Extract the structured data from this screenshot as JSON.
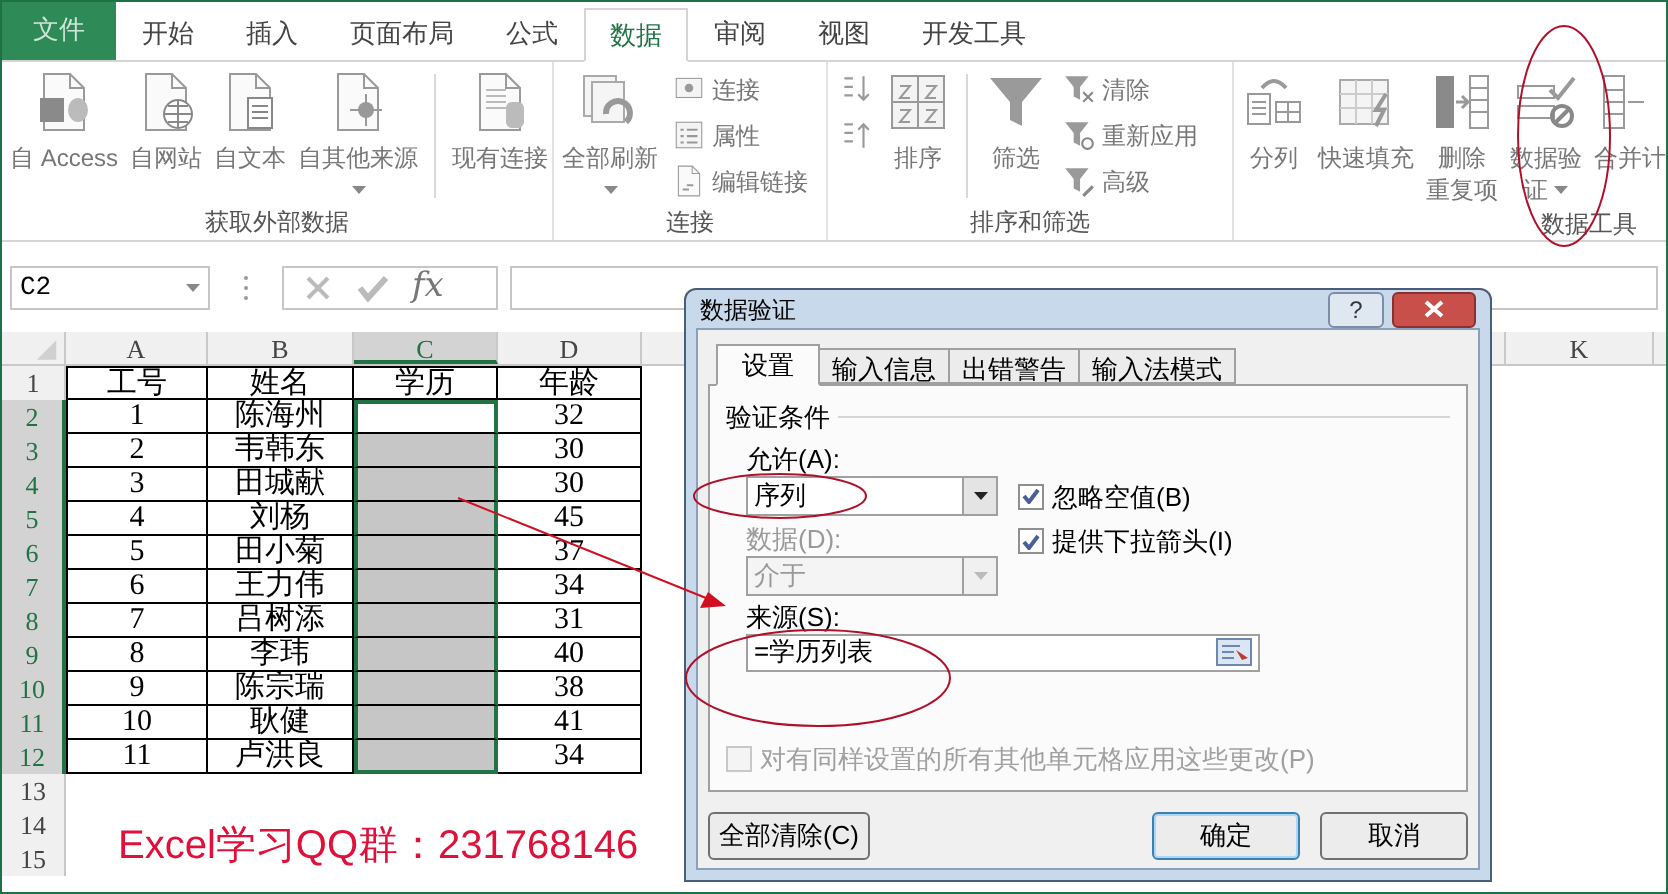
{
  "ribbon_tabs": [
    {
      "label": "文件",
      "kind": "file",
      "selected": false
    },
    {
      "label": "开始",
      "kind": "tab",
      "selected": false
    },
    {
      "label": "插入",
      "kind": "tab",
      "selected": false
    },
    {
      "label": "页面布局",
      "kind": "tab",
      "selected": false
    },
    {
      "label": "公式",
      "kind": "tab",
      "selected": false
    },
    {
      "label": "数据",
      "kind": "tab",
      "selected": true
    },
    {
      "label": "审阅",
      "kind": "tab",
      "selected": false
    },
    {
      "label": "视图",
      "kind": "tab",
      "selected": false
    },
    {
      "label": "开发工具",
      "kind": "tab",
      "selected": false
    }
  ],
  "ribbon_groups": [
    {
      "label": "获取外部数据",
      "buttons": [
        {
          "kind": "large",
          "lines": [
            "自 Access"
          ]
        },
        {
          "kind": "large",
          "lines": [
            "自网站"
          ]
        },
        {
          "kind": "large",
          "lines": [
            "自文本"
          ]
        },
        {
          "kind": "large",
          "lines": [
            "自其他来源"
          ],
          "dropdown": true
        },
        {
          "kind": "large",
          "lines": [
            "现有连接"
          ],
          "divider_before": true
        }
      ]
    },
    {
      "label": "连接",
      "buttons": [
        {
          "kind": "large",
          "lines": [
            "全部刷新"
          ],
          "dropdown": true
        },
        {
          "kind": "stack",
          "items": [
            {
              "kind": "text",
              "label": "连接"
            },
            {
              "kind": "text",
              "label": "属性"
            },
            {
              "kind": "text",
              "label": "编辑链接"
            }
          ]
        }
      ]
    },
    {
      "label": "排序和筛选",
      "buttons": [
        {
          "kind": "stack",
          "items": [
            {
              "kind": "icon"
            },
            {
              "kind": "icon"
            }
          ]
        },
        {
          "kind": "large",
          "lines": [
            "排序"
          ]
        },
        {
          "kind": "large",
          "lines": [
            "筛选"
          ],
          "divider_before": true
        },
        {
          "kind": "stack",
          "items": [
            {
              "kind": "text",
              "label": "清除"
            },
            {
              "kind": "text",
              "label": "重新应用"
            },
            {
              "kind": "text",
              "label": "高级"
            }
          ]
        }
      ]
    },
    {
      "label": "数据工具",
      "buttons": [
        {
          "kind": "large",
          "lines": [
            "分列"
          ]
        },
        {
          "kind": "large",
          "lines": [
            "快速填充"
          ]
        },
        {
          "kind": "large",
          "lines": [
            "删除",
            "重复项"
          ]
        },
        {
          "kind": "large",
          "lines": [
            "数据验",
            "证"
          ],
          "dropdown": true
        },
        {
          "kind": "large",
          "lines": [
            "合并计"
          ]
        }
      ]
    }
  ],
  "formula_bar": {
    "name_box": "C2",
    "function_button": "fx"
  },
  "sheet": {
    "columns": [
      {
        "label": "A",
        "selected": false
      },
      {
        "label": "B",
        "selected": false
      },
      {
        "label": "C",
        "selected": true
      },
      {
        "label": "D",
        "selected": false
      },
      {
        "label": "K",
        "selected": false
      }
    ],
    "row_headers": [
      {
        "label": "1",
        "selected": false
      },
      {
        "label": "2",
        "selected": true
      },
      {
        "label": "3",
        "selected": true
      },
      {
        "label": "4",
        "selected": true
      },
      {
        "label": "5",
        "selected": true
      },
      {
        "label": "6",
        "selected": true
      },
      {
        "label": "7",
        "selected": true
      },
      {
        "label": "8",
        "selected": true
      },
      {
        "label": "9",
        "selected": true
      },
      {
        "label": "10",
        "selected": true
      },
      {
        "label": "11",
        "selected": true
      },
      {
        "label": "12",
        "selected": true
      },
      {
        "label": "13",
        "selected": false
      },
      {
        "label": "14",
        "selected": false
      },
      {
        "label": "15",
        "selected": false
      }
    ],
    "table_headers": [
      "工号",
      "姓名",
      "学历",
      "年龄"
    ],
    "rows": [
      {
        "id": "1",
        "name": "陈海州",
        "age": "32",
        "active": true
      },
      {
        "id": "2",
        "name": "韦韩东",
        "age": "30",
        "active": false
      },
      {
        "id": "3",
        "name": "田城献",
        "age": "30",
        "active": false
      },
      {
        "id": "4",
        "name": "刘杨",
        "age": "45",
        "active": false
      },
      {
        "id": "5",
        "name": "田小菊",
        "age": "37",
        "active": false
      },
      {
        "id": "6",
        "name": "王力伟",
        "age": "34",
        "active": false
      },
      {
        "id": "7",
        "name": "吕树添",
        "age": "31",
        "active": false
      },
      {
        "id": "8",
        "name": "李玮",
        "age": "40",
        "active": false
      },
      {
        "id": "9",
        "name": "陈宗瑞",
        "age": "38",
        "active": false
      },
      {
        "id": "10",
        "name": "耿健",
        "age": "41",
        "active": false
      },
      {
        "id": "11",
        "name": "卢洪良",
        "age": "34",
        "active": false
      }
    ],
    "note": "Excel学习QQ群：231768146"
  },
  "dialog": {
    "title": "数据验证",
    "help_button": "?",
    "tabs": [
      {
        "label": "设置",
        "selected": true
      },
      {
        "label": "输入信息",
        "selected": false
      },
      {
        "label": "出错警告",
        "selected": false
      },
      {
        "label": "输入法模式",
        "selected": false
      }
    ],
    "section": "验证条件",
    "allow_label": "允许(A):",
    "allow_value": "序列",
    "checkboxes": [
      {
        "label": "忽略空值(B)",
        "checked": true
      },
      {
        "label": "提供下拉箭头(I)",
        "checked": true
      }
    ],
    "data_label": "数据(D):",
    "data_value": "介于",
    "data_disabled": true,
    "source_label": "来源(S):",
    "source_value": "=学历列表",
    "apply_all": {
      "label": "对有同样设置的所有其他单元格应用这些更改(P)",
      "checked": false,
      "disabled": true
    },
    "buttons": [
      {
        "label": "全部清除(C)",
        "default": false
      },
      {
        "label": "确定",
        "default": true
      },
      {
        "label": "取消",
        "default": false
      }
    ]
  }
}
